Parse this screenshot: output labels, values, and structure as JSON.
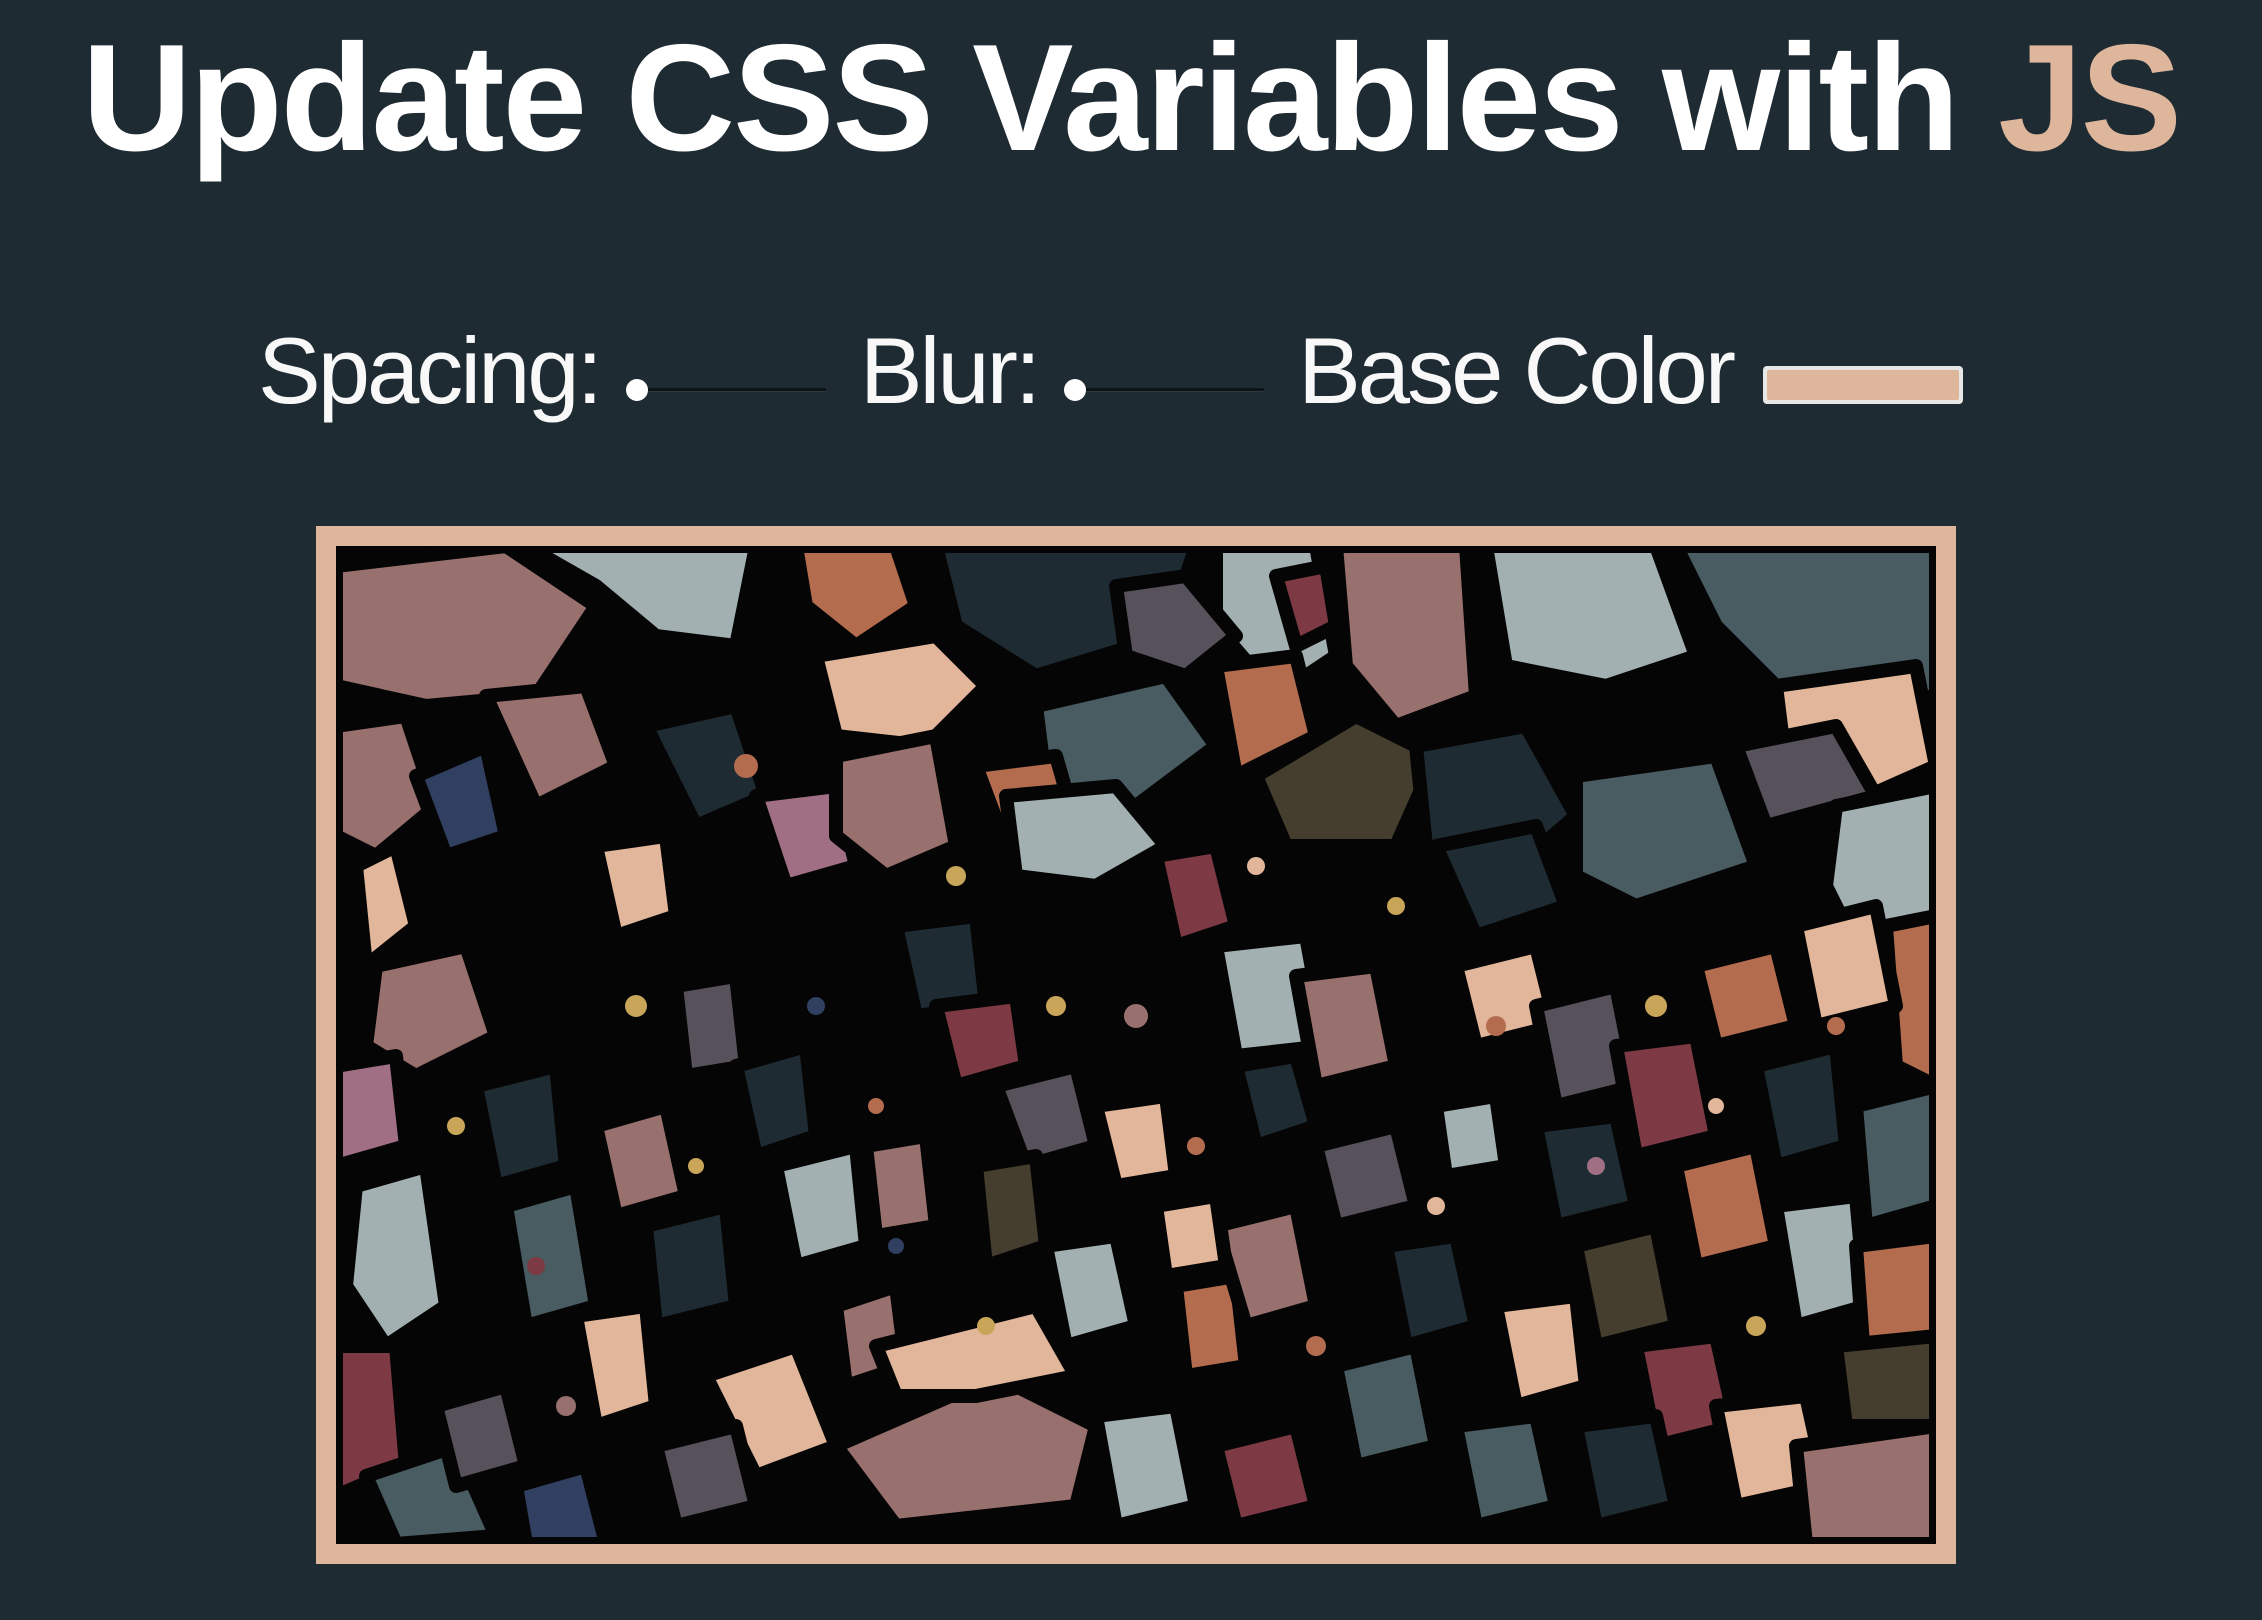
{
  "header": {
    "title_main": "Update CSS Variables with",
    "title_highlight": "JS"
  },
  "controls": {
    "spacing": {
      "label": "Spacing:",
      "value": 0
    },
    "blur": {
      "label": "Blur:",
      "value": 0
    },
    "base_color": {
      "label": "Base Color",
      "value": "#deb69b"
    }
  },
  "colors": {
    "background": "#1f2b33",
    "accent": "#deb69b",
    "text": "#ffffff"
  },
  "image": {
    "description_icon": "stained-glass-mosaic-image"
  }
}
